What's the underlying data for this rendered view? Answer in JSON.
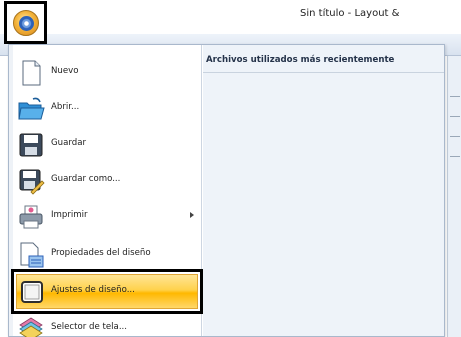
{
  "window": {
    "title": "Sin título - Layout &"
  },
  "application_button": {
    "icon": "application-orb-icon"
  },
  "recent_files": {
    "header": "Archivos utilizados más recientemente"
  },
  "menu": {
    "items": [
      {
        "label": "Nuevo",
        "icon": "new-document-icon"
      },
      {
        "label": "Abrir...",
        "icon": "open-folder-icon"
      },
      {
        "label": "Guardar",
        "icon": "save-disk-icon"
      },
      {
        "label": "Guardar como...",
        "icon": "save-as-icon"
      },
      {
        "label": "Imprimir",
        "icon": "printer-icon",
        "has_submenu": true
      },
      {
        "label": "Propiedades del diseño",
        "icon": "design-properties-icon"
      },
      {
        "label": "Ajustes de diseño...",
        "icon": "design-settings-icon",
        "highlighted": true
      },
      {
        "label": "Selector de tela...",
        "icon": "fabric-selector-icon"
      }
    ]
  },
  "colors": {
    "highlight": "#ffd24c",
    "menu_background": "#eef3f9",
    "accent_blue": "#2c61b8"
  }
}
